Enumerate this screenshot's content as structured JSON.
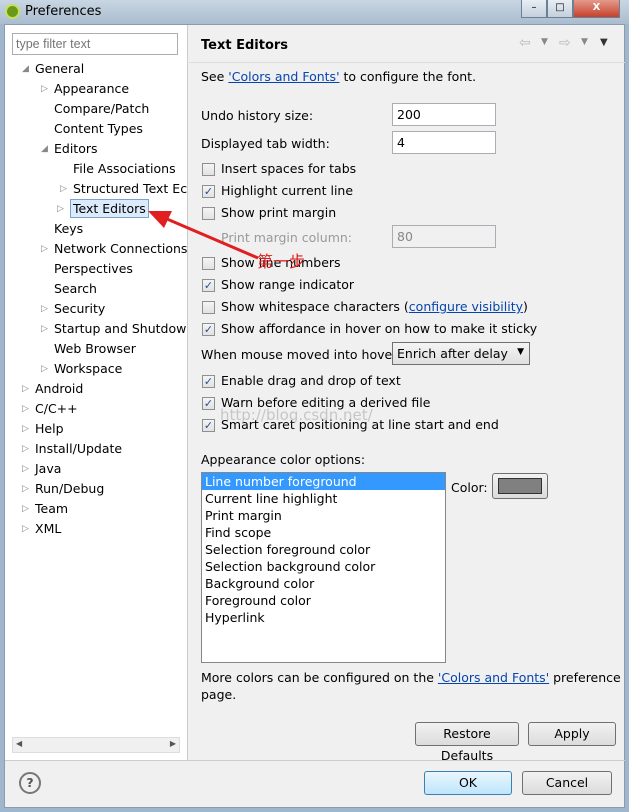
{
  "window": {
    "title": "Preferences",
    "minimize": "–",
    "maximize": "□",
    "close": "X"
  },
  "filter": {
    "placeholder": "type filter text"
  },
  "tree": [
    {
      "label": "General",
      "depth": 0,
      "tw": "◢"
    },
    {
      "label": "Appearance",
      "depth": 1,
      "tw": "▷"
    },
    {
      "label": "Compare/Patch",
      "depth": 1,
      "tw": ""
    },
    {
      "label": "Content Types",
      "depth": 1,
      "tw": ""
    },
    {
      "label": "Editors",
      "depth": 1,
      "tw": "◢"
    },
    {
      "label": "File Associations",
      "depth": 2,
      "tw": ""
    },
    {
      "label": "Structured Text Ec",
      "depth": 2,
      "tw": "▷"
    },
    {
      "label": "Text Editors",
      "depth": 2,
      "tw": "▷",
      "selected": true
    },
    {
      "label": "Keys",
      "depth": 1,
      "tw": ""
    },
    {
      "label": "Network Connections",
      "depth": 1,
      "tw": "▷"
    },
    {
      "label": "Perspectives",
      "depth": 1,
      "tw": ""
    },
    {
      "label": "Search",
      "depth": 1,
      "tw": ""
    },
    {
      "label": "Security",
      "depth": 1,
      "tw": "▷"
    },
    {
      "label": "Startup and Shutdow",
      "depth": 1,
      "tw": "▷"
    },
    {
      "label": "Web Browser",
      "depth": 1,
      "tw": ""
    },
    {
      "label": "Workspace",
      "depth": 1,
      "tw": "▷"
    },
    {
      "label": "Android",
      "depth": 0,
      "tw": "▷"
    },
    {
      "label": "C/C++",
      "depth": 0,
      "tw": "▷"
    },
    {
      "label": "Help",
      "depth": 0,
      "tw": "▷"
    },
    {
      "label": "Install/Update",
      "depth": 0,
      "tw": "▷"
    },
    {
      "label": "Java",
      "depth": 0,
      "tw": "▷"
    },
    {
      "label": "Run/Debug",
      "depth": 0,
      "tw": "▷"
    },
    {
      "label": "Team",
      "depth": 0,
      "tw": "▷"
    },
    {
      "label": "XML",
      "depth": 0,
      "tw": "▷"
    }
  ],
  "page": {
    "title": "Text Editors",
    "see_pre": "See ",
    "see_link": "'Colors and Fonts'",
    "see_post": " to configure the font.",
    "undo_label": "Undo history size:",
    "undo_value": "200",
    "tab_label": "Displayed tab width:",
    "tab_value": "4",
    "checks": [
      {
        "label": "Insert spaces for tabs",
        "checked": false
      },
      {
        "label": "Highlight current line",
        "checked": true
      },
      {
        "label": "Show print margin",
        "checked": false
      }
    ],
    "margin_label": "Print margin column:",
    "margin_value": "80",
    "checks2": [
      {
        "label": "Show line numbers",
        "checked": false
      },
      {
        "label": "Show range indicator",
        "checked": true
      },
      {
        "label": "Show whitespace characters",
        "checked": false
      },
      {
        "label": "Show affordance in hover on how to make it sticky",
        "checked": true
      }
    ],
    "ws_link": "configure visibility",
    "hover_label": "When mouse moved into hover:",
    "hover_value": "Enrich after delay",
    "checks3": [
      {
        "label": "Enable drag and drop of text",
        "checked": true
      },
      {
        "label": "Warn before editing a derived file",
        "checked": true
      },
      {
        "label": "Smart caret positioning at line start and end",
        "checked": true
      }
    ],
    "appearance_label": "Appearance color options:",
    "color_items": [
      "Line number foreground",
      "Current line highlight",
      "Print margin",
      "Find scope",
      "Selection foreground color",
      "Selection background color",
      "Background color",
      "Foreground color",
      "Hyperlink"
    ],
    "color_label": "Color:",
    "color_value": "#808080",
    "more_pre": "More colors can be configured on the ",
    "more_link": "'Colors and Fonts'",
    "more_post": " preference",
    "more_line2": "page.",
    "restore": "Restore Defaults",
    "apply": "Apply"
  },
  "footer": {
    "help": "?",
    "ok": "OK",
    "cancel": "Cancel"
  },
  "annotation": "第一步",
  "watermark": "http://blog.csdn.net/"
}
